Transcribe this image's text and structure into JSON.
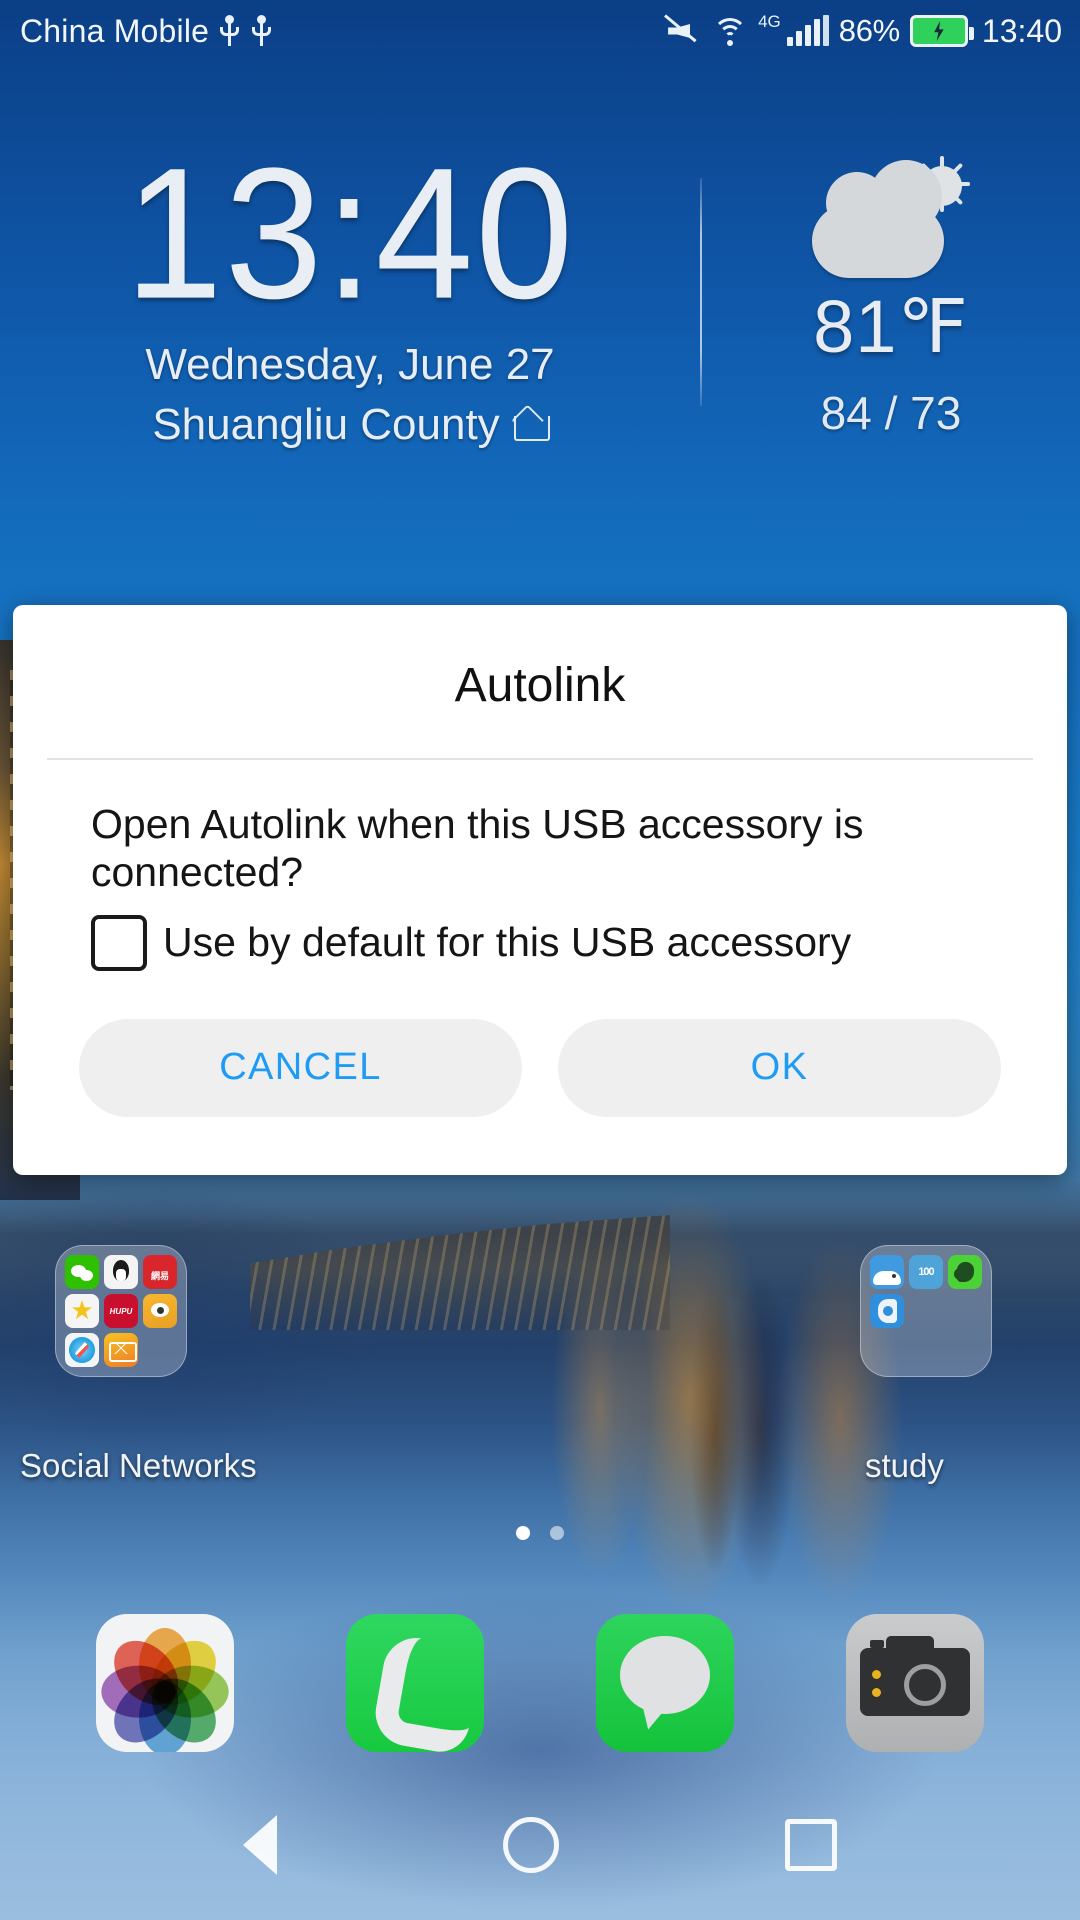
{
  "status_bar": {
    "carrier": "China Mobile",
    "usb_icons": [
      "usb-icon",
      "usb-icon"
    ],
    "mute_icon": "mute-icon",
    "wifi_icon": "wifi-icon",
    "network_type": "4G",
    "signal_icon": "signal-bars-icon",
    "battery_percent": "86%",
    "battery_icon": "battery-charging-icon",
    "time": "13:40"
  },
  "widget": {
    "clock": "13:40",
    "date": "Wednesday, June 27",
    "location": "Shuangliu County",
    "home_icon": "home-icon",
    "weather": {
      "icon": "partly-cloudy-icon",
      "temperature": "81℉",
      "high_low": "84 / 73"
    }
  },
  "dialog": {
    "title": "Autolink",
    "message": "Open Autolink when this USB accessory is connected?",
    "checkbox_label": "Use by default for this USB accessory",
    "checkbox_checked": false,
    "cancel_label": "CANCEL",
    "ok_label": "OK",
    "accent_color": "#1e9bf5",
    "button_bg": "#efefef"
  },
  "home": {
    "folders": [
      {
        "name": "Social Networks",
        "label": "Social Networks",
        "apps": [
          {
            "name": "WeChat",
            "icon": "wechat-icon",
            "cls": "ic-wechat",
            "text": ""
          },
          {
            "name": "QQ",
            "icon": "qq-icon",
            "cls": "ic-qq",
            "text": ""
          },
          {
            "name": "NetEase News",
            "icon": "netease-news-icon",
            "cls": "ic-netease",
            "text": "網易"
          },
          {
            "name": "Zhihu",
            "icon": "zhihu-icon",
            "cls": "ic-zhihu",
            "text": ""
          },
          {
            "name": "HUPU",
            "icon": "hupu-icon",
            "cls": "ic-hupu",
            "text": "HUPU"
          },
          {
            "name": "Weibo",
            "icon": "weibo-icon",
            "cls": "ic-weibo",
            "text": ""
          },
          {
            "name": "Safari",
            "icon": "safari-icon",
            "cls": "ic-safari",
            "text": ""
          },
          {
            "name": "Mail",
            "icon": "mail-icon",
            "cls": "ic-mail",
            "text": ""
          }
        ]
      },
      {
        "name": "study",
        "label": "study",
        "apps": [
          {
            "name": "Whale Browser",
            "icon": "whale-icon",
            "cls": "ic-whale",
            "text": ""
          },
          {
            "name": "100",
            "icon": "hundred-icon",
            "cls": "ic-100",
            "text": "100"
          },
          {
            "name": "Evernote",
            "icon": "evernote-icon",
            "cls": "ic-evernote",
            "text": ""
          },
          {
            "name": "DingTalk",
            "icon": "dingtalk-icon",
            "cls": "ic-dingtalk",
            "text": ""
          }
        ]
      }
    ],
    "page_dots": {
      "count": 2,
      "active_index": 0
    },
    "dock": [
      {
        "name": "Photos",
        "icon": "photos-icon"
      },
      {
        "name": "Phone",
        "icon": "phone-icon"
      },
      {
        "name": "Messages",
        "icon": "messages-icon"
      },
      {
        "name": "Camera",
        "icon": "camera-icon"
      }
    ]
  },
  "navbar": {
    "back": "back-icon",
    "home": "home-circle-icon",
    "recents": "recents-square-icon"
  }
}
